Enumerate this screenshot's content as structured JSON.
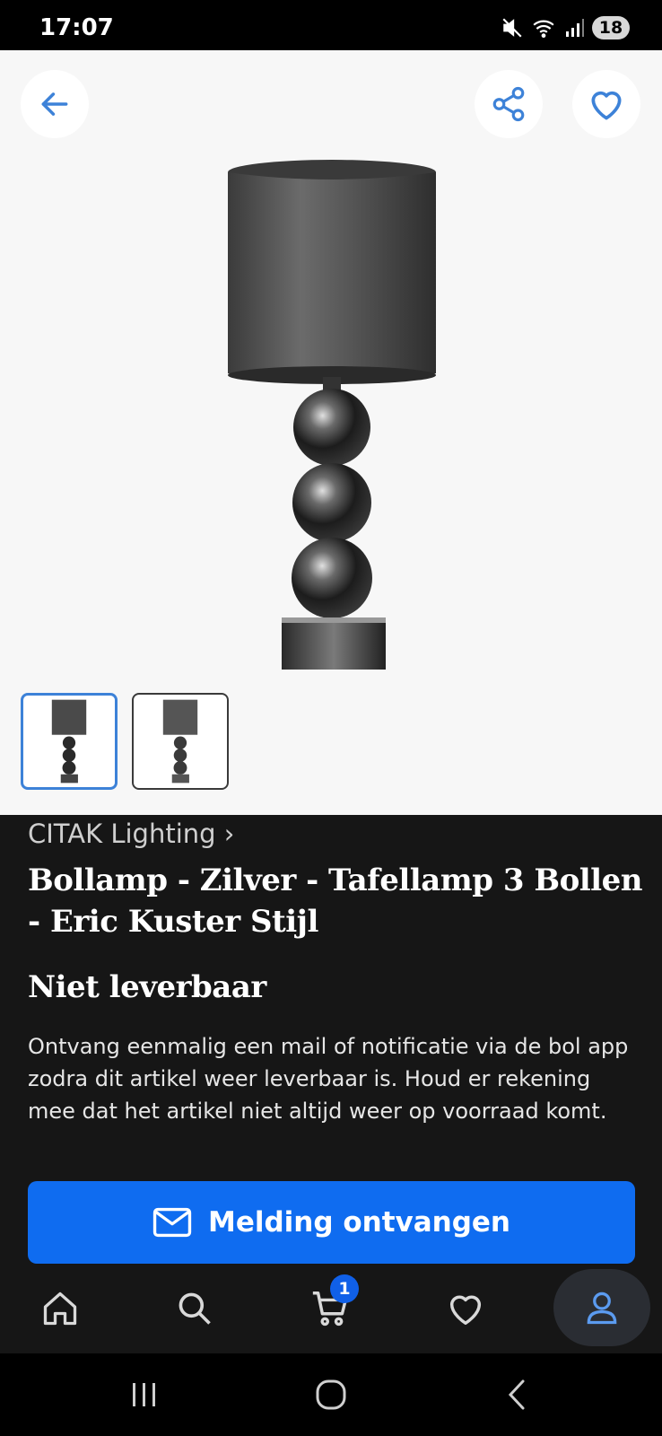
{
  "status_bar": {
    "time": "17:07",
    "battery": "18"
  },
  "gallery": {
    "active_thumbnail": 1,
    "thumbnail_count": 2
  },
  "product": {
    "brand": "CITAK Lighting",
    "title": "Bollamp - Zilver - Tafellamp 3 Bollen - Eric Kuster Stijl",
    "availability": "Niet leverbaar",
    "notify_text": "Ontvang eenmalig een mail of notificatie via de bol app zodra dit artikel weer leverbaar is. Houd er rekening mee dat het artikel niet altijd weer op voorraad komt.",
    "notify_button_label": "Melding ontvangen"
  },
  "bottom_nav": {
    "items": [
      {
        "icon": "home-icon"
      },
      {
        "icon": "search-icon"
      },
      {
        "icon": "cart-icon"
      },
      {
        "icon": "heart-icon"
      },
      {
        "icon": "account-icon",
        "active": true
      }
    ],
    "cart_badge": "1"
  },
  "icons": {
    "back": "arrow-left-icon",
    "share": "share-icon",
    "favorite": "heart-outline-icon",
    "mail": "mail-icon",
    "recents": "recents-icon",
    "home_system": "home-circle-icon",
    "back_system": "chevron-left-icon"
  },
  "colors": {
    "accent": "#0f6cf0",
    "icon_blue": "#3d82d8",
    "background": "#161616",
    "gallery_bg": "#f7f7f7",
    "nav_active_bg": "#2a2d33"
  }
}
